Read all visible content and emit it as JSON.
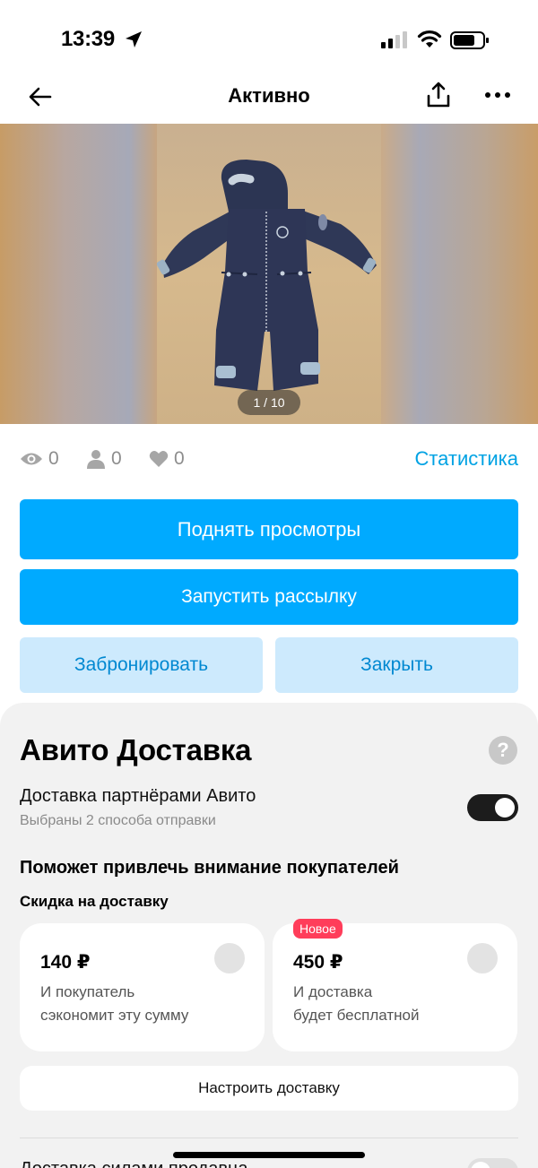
{
  "status_bar": {
    "time": "13:39"
  },
  "nav": {
    "title": "Активно"
  },
  "photo": {
    "counter": "1 / 10"
  },
  "stats": {
    "views": "0",
    "contacts": "0",
    "favorites": "0",
    "link": "Статистика"
  },
  "actions": {
    "raise_views": "Поднять просмотры",
    "start_mailing": "Запустить рассылку",
    "reserve": "Забронировать",
    "close": "Закрыть"
  },
  "delivery": {
    "title": "Авито Доставка",
    "help": "?",
    "partners_title": "Доставка партнёрами Авито",
    "partners_subtitle": "Выбраны 2 способа отправки",
    "partners_enabled": true,
    "attract_heading": "Поможет привлечь внимание покупателей",
    "discount_label": "Скидка на доставку",
    "options": [
      {
        "price": "140 ₽",
        "line1": "И покупатель",
        "line2": "сэкономит эту сумму"
      },
      {
        "badge": "Новое",
        "price": "450 ₽",
        "line1": "И доставка",
        "line2": "будет бесплатной"
      }
    ],
    "setup_button": "Настроить доставку",
    "bottom_text": "Доставка силами продавца"
  },
  "colors": {
    "accent": "#00aaff",
    "light_button": "#cdeafd",
    "link": "#00a2e3",
    "badge": "#ff3d5a"
  }
}
